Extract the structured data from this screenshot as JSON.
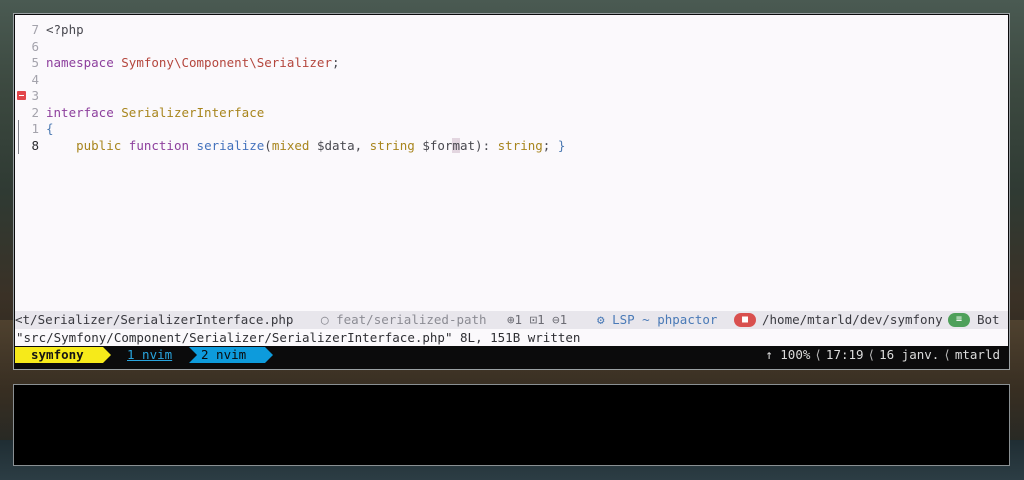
{
  "editor": {
    "lines": [
      {
        "num": "7",
        "current": false,
        "sign": false,
        "gitbar": false,
        "parts": [
          [
            "pun",
            "<?php"
          ]
        ]
      },
      {
        "num": "6",
        "current": false,
        "sign": false,
        "gitbar": false,
        "parts": []
      },
      {
        "num": "5",
        "current": false,
        "sign": false,
        "gitbar": false,
        "parts": [
          [
            "kw",
            "namespace"
          ],
          [
            "pun",
            " "
          ],
          [
            "ns",
            "Symfony\\Component\\Serializer"
          ],
          [
            "pun",
            ";"
          ]
        ]
      },
      {
        "num": "4",
        "current": false,
        "sign": false,
        "gitbar": false,
        "parts": []
      },
      {
        "num": "3",
        "current": false,
        "sign": true,
        "gitbar": false,
        "parts": []
      },
      {
        "num": "2",
        "current": false,
        "sign": false,
        "gitbar": false,
        "parts": [
          [
            "kw",
            "interface"
          ],
          [
            "pun",
            " "
          ],
          [
            "cls",
            "SerializerInterface"
          ]
        ]
      },
      {
        "num": "1",
        "current": false,
        "sign": false,
        "gitbar": true,
        "parts": [
          [
            "brace",
            "{"
          ]
        ]
      },
      {
        "num": "8",
        "current": true,
        "sign": false,
        "gitbar": true,
        "parts": [
          [
            "pun",
            "    "
          ],
          [
            "cls",
            "public"
          ],
          [
            "pun",
            " "
          ],
          [
            "kw",
            "function"
          ],
          [
            "pun",
            " "
          ],
          [
            "fn",
            "serialize"
          ],
          [
            "pun",
            "("
          ],
          [
            "ty",
            "mixed"
          ],
          [
            "var",
            " $data, "
          ],
          [
            "ty",
            "string"
          ],
          [
            "var",
            " $for"
          ],
          [
            "cursor",
            "m"
          ],
          [
            "var",
            "at): "
          ],
          [
            "ty",
            "string"
          ],
          [
            "pun",
            "; "
          ],
          [
            "brace",
            "}"
          ]
        ]
      }
    ]
  },
  "statusline": {
    "file": "<t/Serializer/SerializerInterface.php",
    "branch_icon": "github-icon",
    "branch": "feat/serialized-path",
    "diagnostics": "⊕1 ⊡1 ⊖1",
    "lsp": "LSP ~ phpactor",
    "lsp_icon": "gears-icon",
    "folder_icon": "folder-icon",
    "path": "/home/mtarld/dev/symfony",
    "position_icon": "document-icon",
    "position": "Bot"
  },
  "cmdline": "\"src/Symfony/Component/Serializer/SerializerInterface.php\" 8L, 151B written",
  "tmux": {
    "session": "symfony",
    "windows": [
      {
        "label": "1 nvim",
        "active": false
      },
      {
        "label": "2 nvim",
        "active": true
      }
    ],
    "right": {
      "scroll": "↑ 100%",
      "time": "17:19",
      "date": "16 janv.",
      "user": "mtarld"
    }
  },
  "colors": {
    "session_bg": "#f6ea1a",
    "active_window_bg": "#0d9bdc",
    "editor_bg": "#fbf9fc",
    "statusline_bg": "#e8e6ec"
  }
}
